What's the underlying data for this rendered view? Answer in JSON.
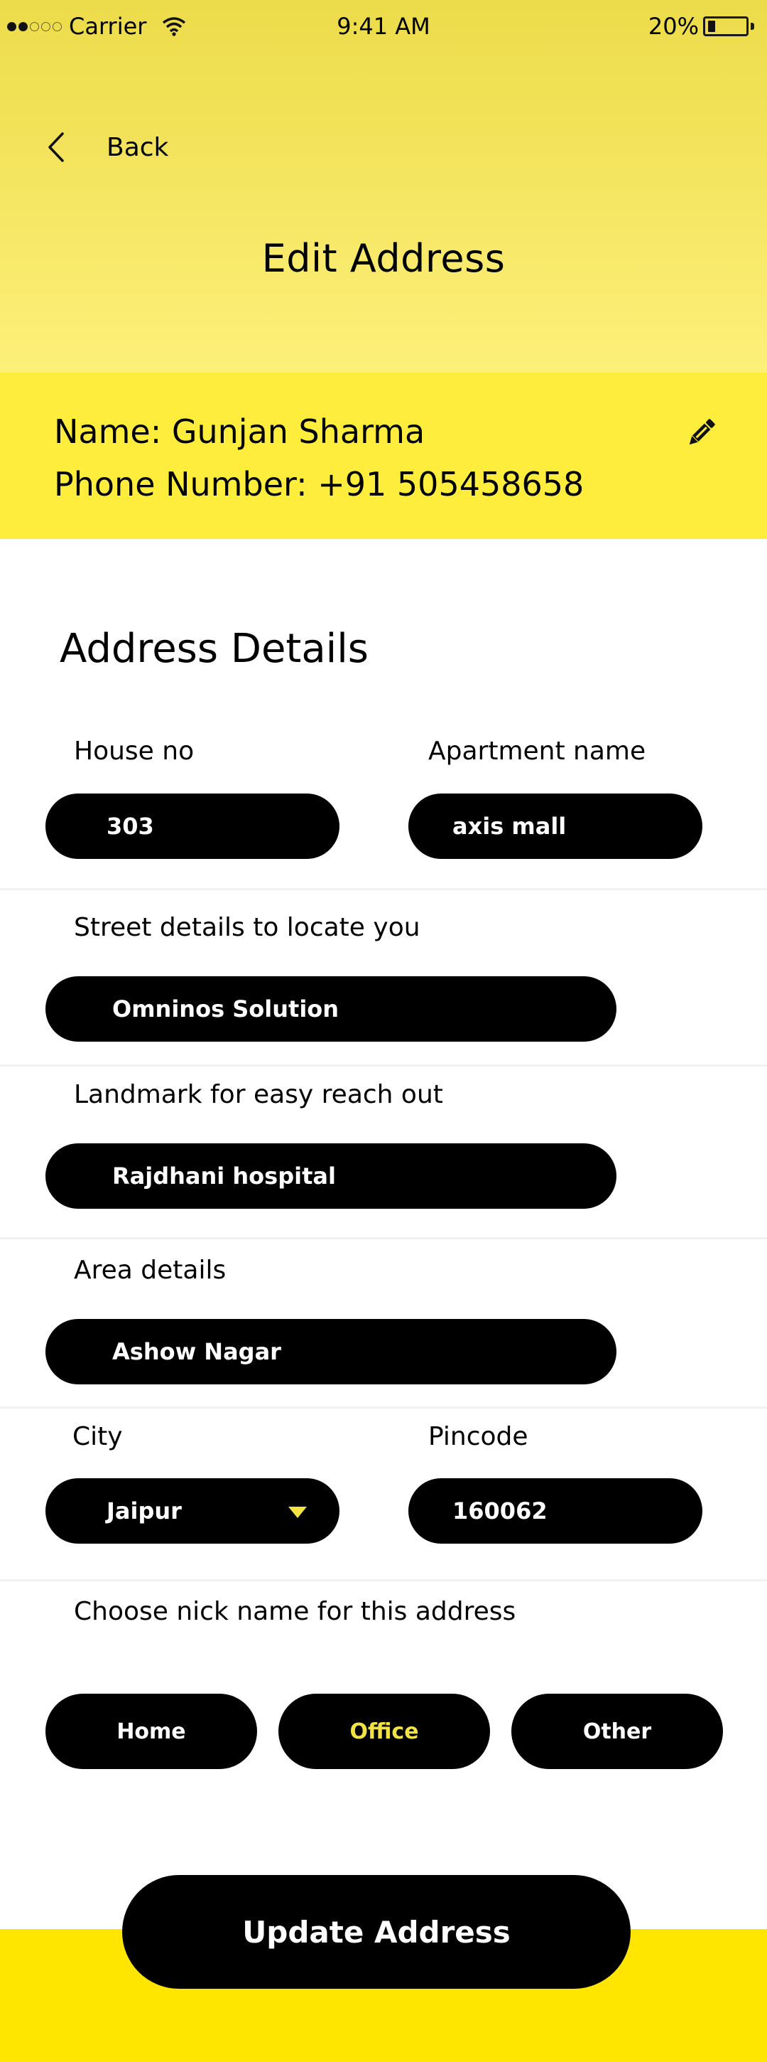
{
  "status_bar": {
    "carrier": "Carrier",
    "signal_filled": 2,
    "signal_total": 5,
    "time": "9:41 AM",
    "battery_percent": "20%",
    "battery_level": 0.2
  },
  "header": {
    "back_label": "Back",
    "title": "Edit Address"
  },
  "contact": {
    "name": "Name: Gunjan Sharma",
    "phone": "Phone Number: +91 505458658",
    "edit_icon": "pencil-icon"
  },
  "address": {
    "section_title": "Address Details",
    "house_no": {
      "label": "House no",
      "value": "303"
    },
    "apartment": {
      "label": "Apartment name",
      "value": "axis mall"
    },
    "street": {
      "label": "Street details to locate you",
      "value": "Omninos Solution"
    },
    "landmark": {
      "label": "Landmark for easy reach out",
      "value": "Rajdhani hospital"
    },
    "area": {
      "label": "Area details",
      "value": "Ashow Nagar"
    },
    "city": {
      "label": "City",
      "value": "Jaipur"
    },
    "pincode": {
      "label": "Pincode",
      "value": "160062"
    }
  },
  "nickname": {
    "label": "Choose nick name for this address",
    "options": [
      "Home",
      "Office",
      "Other"
    ],
    "selected": "Office"
  },
  "actions": {
    "update_label": "Update Address"
  },
  "colors": {
    "accent_yellow": "#feed3c",
    "footer_yellow": "#ffe600",
    "selected_text": "#f2e342",
    "pill_bg": "#000000"
  }
}
